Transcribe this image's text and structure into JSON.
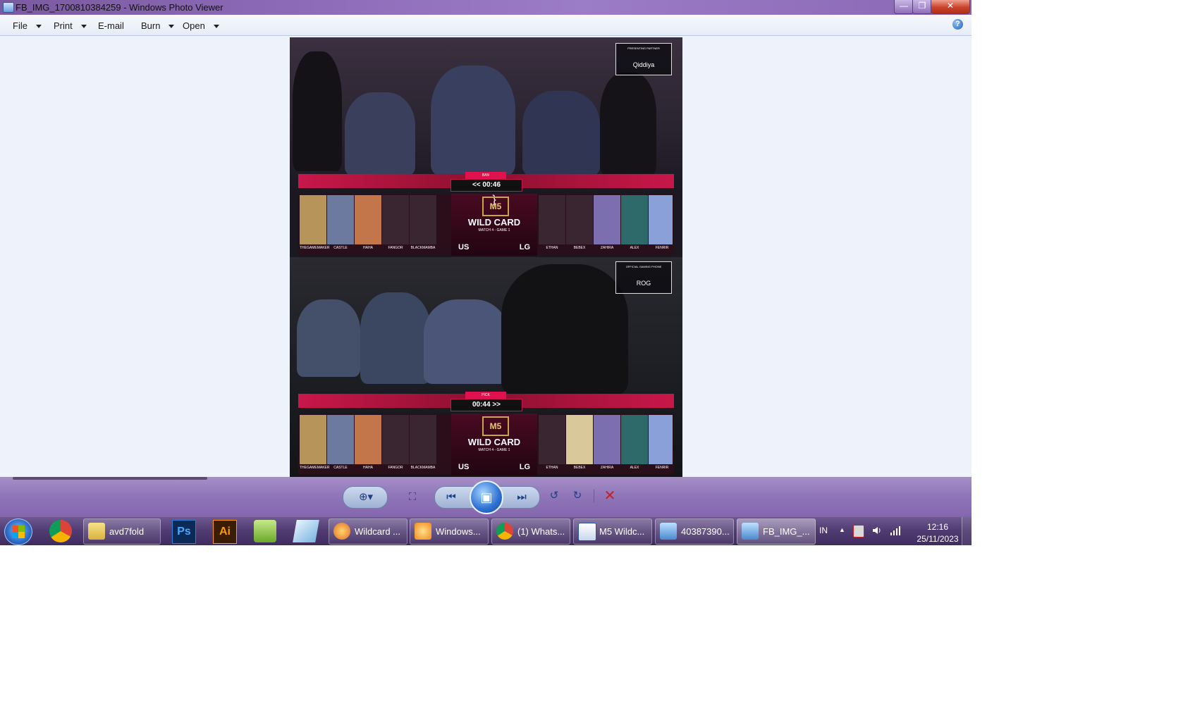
{
  "window": {
    "title": "FB_IMG_1700810384259 - Windows Photo Viewer",
    "min_glyph": "—",
    "max_glyph": "❐",
    "close_glyph": "✕"
  },
  "menu": {
    "file": "File",
    "print": "Print",
    "email": "E-mail",
    "burn": "Burn",
    "open": "Open",
    "help_glyph": "?"
  },
  "photo": {
    "top": {
      "timer": "<< 00:46",
      "phase": "BAN",
      "sponsor_caption": "PRESENTING PARTNER",
      "sponsor_name": "Qiddiya",
      "card_logo": "M5",
      "card_title": "WILD CARD",
      "card_sub": "MATCH 4 - GAME 1",
      "team_left": "US",
      "team_right": "LG",
      "left_players": [
        "THEGAMEMAKER",
        "CASTLE",
        "HAHA",
        "FANGOR",
        "BLACKMAMBA"
      ],
      "right_players": [
        "ETHAN",
        "BEBEX",
        "ZAHIRA",
        "ALEX",
        "FENRIR"
      ]
    },
    "bottom": {
      "timer": "00:44 >>",
      "phase": "PICK",
      "sponsor_caption": "OFFICIAL GAMING PHONE",
      "sponsor_name": "ROG",
      "card_logo": "M5",
      "card_title": "WILD CARD",
      "card_sub": "MATCH 4 - GAME 1",
      "team_left": "US",
      "team_right": "LG",
      "left_players": [
        "THEGAMEMAKER",
        "CASTLE",
        "HAHA",
        "FANGOR",
        "BLACKMAMBA"
      ],
      "right_players": [
        "ETHAN",
        "BEBEX",
        "ZAHIRA",
        "ALEX",
        "FENRIR"
      ]
    }
  },
  "controls": {
    "zoom": "⊕▾",
    "fit": "⛶",
    "previous": "⏮",
    "slideshow": "▣",
    "next": "⏭",
    "rotate_ccw": "↺",
    "rotate_cw": "↻",
    "delete": "✕"
  },
  "taskbar": {
    "items": [
      {
        "label": "avd7fold"
      },
      {
        "label": "Wildcard ..."
      },
      {
        "label": "Windows..."
      },
      {
        "label": "(1) Whats..."
      },
      {
        "label": "M5 Wildc..."
      },
      {
        "label": "40387390..."
      },
      {
        "label": "FB_IMG_..."
      }
    ],
    "pinned": {
      "ps": "Ps",
      "ai": "Ai"
    },
    "tray": {
      "lang": "IN",
      "arrow": "▲",
      "time": "12:16",
      "date": "25/11/2023"
    }
  },
  "colors": {
    "accent": "#c8174a",
    "titlebar": "#8d6ab8",
    "taskbar": "#4f3b71"
  }
}
